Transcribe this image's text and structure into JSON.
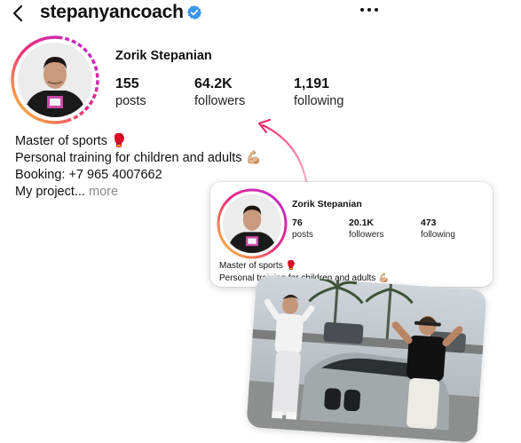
{
  "header": {
    "back_icon": "chevron-left-icon",
    "username": "stepanyancoach",
    "verified_icon": "verified-badge-icon",
    "more_icon": "more-horizontal-icon"
  },
  "profile": {
    "name": "Zorik Stepanian",
    "stats": [
      {
        "value": "155",
        "label": "posts"
      },
      {
        "value": "64.2K",
        "label": "followers"
      },
      {
        "value": "1,191",
        "label": "following"
      }
    ],
    "bio": {
      "line1": "Master of sports 🥊",
      "line2": "Personal training for children and adults 💪🏼",
      "line3": "Booking: +7 965 4007662",
      "line4": "My project...",
      "more": "more"
    }
  },
  "card": {
    "name": "Zorik Stepanian",
    "stats": [
      {
        "value": "76",
        "label": "posts"
      },
      {
        "value": "20.1K",
        "label": "followers"
      },
      {
        "value": "473",
        "label": "following"
      }
    ],
    "bio": {
      "line1": "Master of sports 🥊",
      "line2": "Personal training for children and adults 💪🏼"
    }
  },
  "colors": {
    "ring_start": "#f9ce34",
    "ring_mid": "#ee2a7b",
    "ring_end": "#6228d7",
    "verified": "#3897f0",
    "arrow": "#ee3a6d"
  }
}
